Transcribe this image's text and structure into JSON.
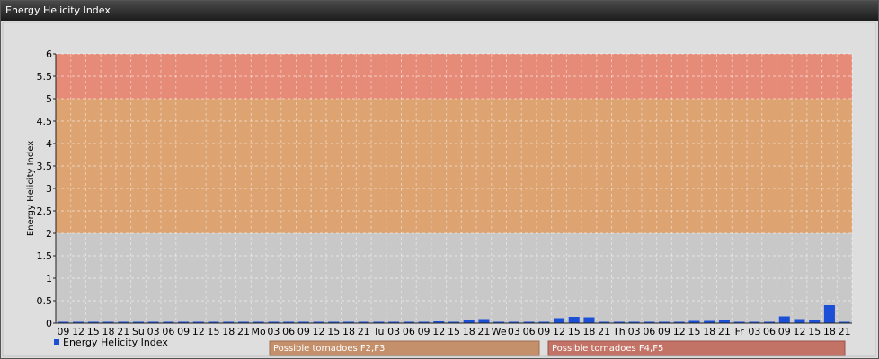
{
  "window": {
    "title": "Energy Helicity Index"
  },
  "chart_data": {
    "type": "bar",
    "ylabel": "Energy Helicity Index",
    "ylim": [
      0,
      6
    ],
    "yticks": [
      "0",
      "0.5",
      "1",
      "1.5",
      "2",
      "2.5",
      "3",
      "3.5",
      "4",
      "4.5",
      "5",
      "5.5",
      "6"
    ],
    "categories": [
      "09",
      "12",
      "15",
      "18",
      "21",
      "Su",
      "03",
      "06",
      "09",
      "12",
      "15",
      "18",
      "21",
      "Mo",
      "03",
      "06",
      "09",
      "12",
      "15",
      "18",
      "21",
      "Tu",
      "03",
      "06",
      "09",
      "12",
      "15",
      "18",
      "21",
      "We",
      "03",
      "06",
      "09",
      "12",
      "15",
      "18",
      "21",
      "Th",
      "03",
      "06",
      "09",
      "12",
      "15",
      "18",
      "21",
      "Fr",
      "03",
      "06",
      "09",
      "12",
      "15",
      "18",
      "21"
    ],
    "series": [
      {
        "name": "Energy Helicity Index",
        "color": "#1a4fd6",
        "values": [
          0,
          0,
          0,
          0,
          0,
          0,
          0,
          0,
          0,
          0,
          0,
          0,
          0,
          0,
          0,
          0,
          0,
          0,
          0,
          0,
          0,
          0,
          0,
          0,
          0,
          0.04,
          0,
          0.06,
          0.09,
          0.02,
          0,
          0,
          0.01,
          0.11,
          0.14,
          0.13,
          0.03,
          0.02,
          0.01,
          0.01,
          0.01,
          0.02,
          0.05,
          0.05,
          0.06,
          0.01,
          0.03,
          0.02,
          0.15,
          0.09,
          0.06,
          0.4,
          0.02
        ]
      }
    ],
    "bands": [
      {
        "from": 2,
        "to": 5,
        "color": "#dda371"
      },
      {
        "from": 5,
        "to": 6,
        "color": "#e68b78"
      }
    ],
    "band_legend": [
      {
        "label": "Possible tornadoes F2,F3",
        "color": "#c4906b"
      },
      {
        "label": "Possible tornadoes F4,F5",
        "color": "#c27366"
      }
    ],
    "grid": true,
    "legend": "bottom-left"
  }
}
